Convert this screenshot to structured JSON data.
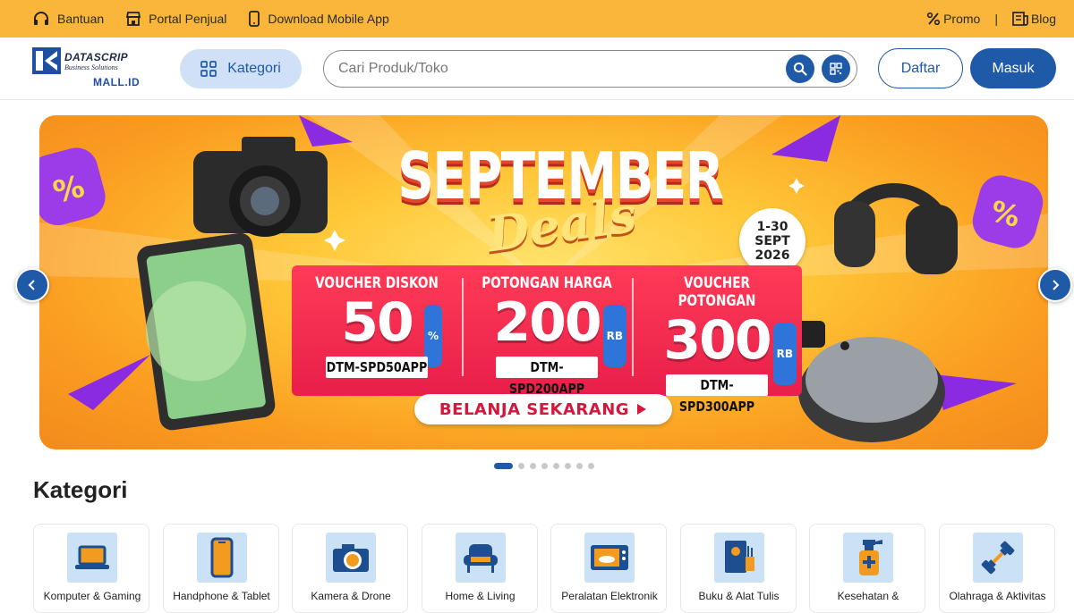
{
  "topbar": {
    "help": "Bantuan",
    "seller_portal": "Portal Penjual",
    "download_app": "Download Mobile App",
    "promo": "Promo",
    "separator": "|",
    "blog": "Blog"
  },
  "header": {
    "logo": {
      "brand": "DATASCRIP",
      "tagline": "Business Solutions",
      "mall": "MALL.ID"
    },
    "category_button": "Kategori",
    "search_placeholder": "Cari Produk/Toko",
    "register_button": "Daftar",
    "login_button": "Masuk"
  },
  "banner": {
    "title": "SEPTEMBER",
    "subtitle": "Deals",
    "date_range": [
      "1-30",
      "SEPT",
      "2026"
    ],
    "offers": [
      {
        "label": "VOUCHER DISKON",
        "value": "50",
        "unit": "%",
        "code": "DTM-SPD50APP"
      },
      {
        "label": "POTONGAN HARGA",
        "value": "200",
        "unit": "RB",
        "code": "DTM-SPD200APP"
      },
      {
        "label": "VOUCHER POTONGAN",
        "value": "300",
        "unit": "RB",
        "code": "DTM-SPD300APP"
      }
    ],
    "cta": "BELANJA SEKARANG",
    "slide_count": 8,
    "active_slide": 1
  },
  "categories_section": {
    "title": "Kategori",
    "items": [
      {
        "label": "Komputer & Gaming",
        "icon": "laptop-icon"
      },
      {
        "label": "Handphone & Tablet",
        "icon": "phone-icon"
      },
      {
        "label": "Kamera & Drone",
        "icon": "camera-icon"
      },
      {
        "label": "Home & Living",
        "icon": "armchair-icon"
      },
      {
        "label": "Peralatan Elektronik",
        "icon": "microwave-icon"
      },
      {
        "label": "Buku & Alat Tulis",
        "icon": "book-icon"
      },
      {
        "label": "Kesehatan &",
        "icon": "spray-bottle-icon"
      },
      {
        "label": "Olahraga & Aktivitas",
        "icon": "dumbbell-icon"
      }
    ]
  },
  "colors": {
    "topbar_bg": "#f9b63b",
    "primary": "#1f5aa8",
    "category_btn_bg": "#cfe0f7",
    "icon_tile_bg": "#cbe1f6"
  }
}
